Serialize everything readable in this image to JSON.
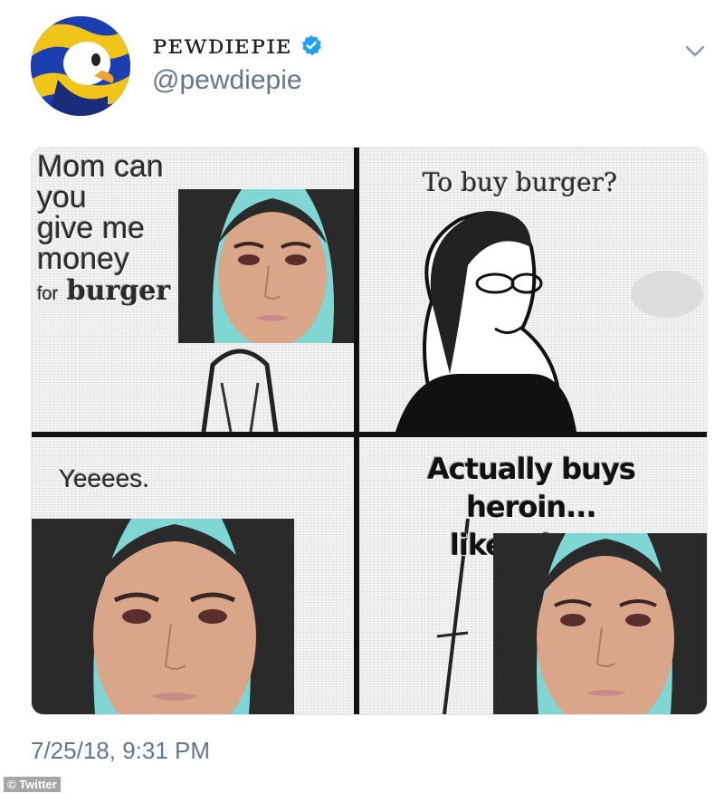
{
  "tweet": {
    "display_name": "ᴘᴇᴡᴅɪᴇᴘɪᴇ",
    "handle": "@pewdiepie",
    "verified": true,
    "timestamp": "7/25/18, 9:31 PM"
  },
  "meme": {
    "panel1": {
      "line1": "Mom can you",
      "line2": "give me",
      "line3": "money",
      "line4_small": "for",
      "line4_big": "burger"
    },
    "panel2": {
      "text": "To buy burger?"
    },
    "panel3": {
      "text": "Yeeees."
    },
    "panel4": {
      "line1": "Actually buys heroin...",
      "line2": "like a boss"
    }
  },
  "watermark": {
    "text": "© Twitter"
  },
  "colors": {
    "verified": "#1da1f2",
    "secondary_text": "#657786",
    "photo_bg": "#7fd6d2"
  },
  "icons": {
    "verified": "verified-badge-icon",
    "menu": "chevron-down-icon"
  }
}
